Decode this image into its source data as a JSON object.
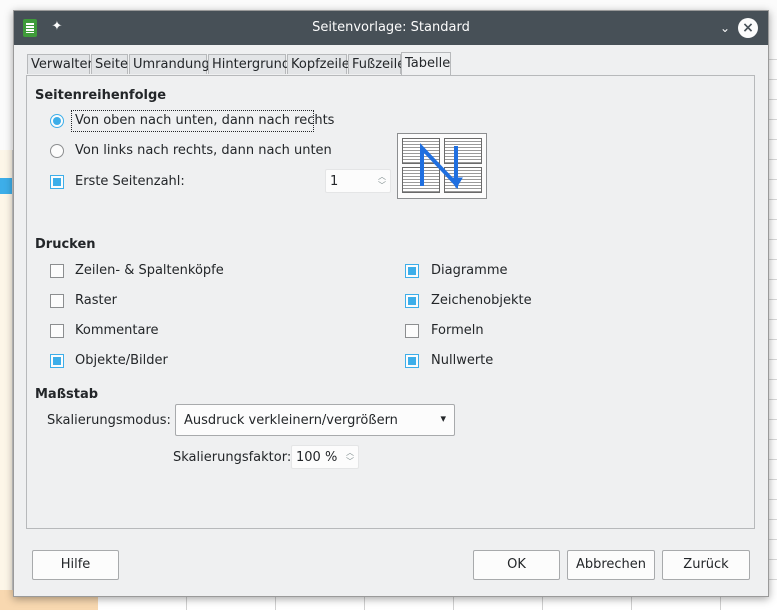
{
  "dialog": {
    "title": "Seitenvorlage: Standard"
  },
  "tabs": [
    {
      "label": "Verwalten"
    },
    {
      "label": "Seite"
    },
    {
      "label": "Umrandung"
    },
    {
      "label": "Hintergrund"
    },
    {
      "label": "Kopfzeile"
    },
    {
      "label": "Fußzeile"
    },
    {
      "label": "Tabelle"
    }
  ],
  "page_order": {
    "heading": "Seitenreihenfolge",
    "option_top_down": "Von oben nach unten, dann nach rechts",
    "option_left_right": "Von links nach rechts, dann nach unten",
    "first_page_label": "Erste Seitenzahl:",
    "first_page_value": "1"
  },
  "print": {
    "heading": "Drucken",
    "items": [
      {
        "label": "Zeilen- & Spaltenköpfe"
      },
      {
        "label": "Raster"
      },
      {
        "label": "Kommentare"
      },
      {
        "label": "Objekte/Bilder"
      },
      {
        "label": "Diagramme"
      },
      {
        "label": "Zeichenobjekte"
      },
      {
        "label": "Formeln"
      },
      {
        "label": "Nullwerte"
      }
    ]
  },
  "scale": {
    "heading": "Maßstab",
    "mode_label": "Skalierungsmodus:",
    "mode_value": "Ausdruck verkleinern/vergrößern",
    "factor_label": "Skalierungsfaktor:",
    "factor_value": "100 %"
  },
  "buttons": {
    "help": "Hilfe",
    "ok": "OK",
    "cancel": "Abbrechen",
    "reset": "Zurück"
  },
  "colors": {
    "accent": "#3daee9",
    "titlebar": "#475057"
  }
}
